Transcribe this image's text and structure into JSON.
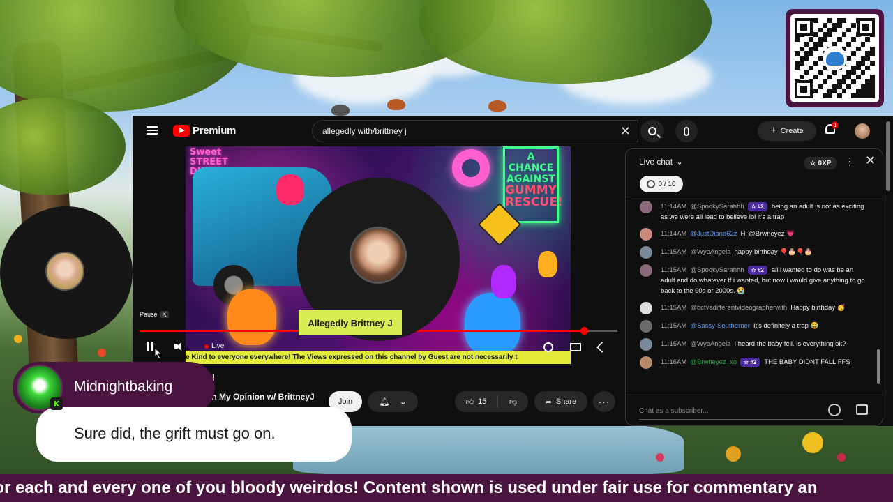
{
  "youtube": {
    "brand": "Premium",
    "search_value": "allegedly with/brittney j",
    "create_label": "Create",
    "notification_count": "1",
    "video": {
      "nameplate": "Allegedly Brittney J",
      "ticker_text": "e Kind to everyone everywhere! The Views expressed on this channel by Guest are not necessarily t",
      "pause_tooltip": "Pause",
      "pause_key": "K",
      "live_label": "Live",
      "progress": 0.93
    },
    "title_fragment": "y!",
    "channel_fragment": "In My Opinion w/ BrittneyJ",
    "join_label": "Join",
    "like_count": "15",
    "share_label": "Share"
  },
  "live_chat": {
    "title": "Live chat",
    "xp_badge": "0XP",
    "goal_pill": "0 / 10",
    "input_placeholder": "Chat as a subscriber...",
    "messages": [
      {
        "time": "11:14AM",
        "author": "@SpookySarahhh",
        "author_style": "default",
        "rank": "#2",
        "text": "being an adult is not as exciting as we were all lead to believe lol it's a trap",
        "avatar_color": "#8a6a7a"
      },
      {
        "time": "11:14AM",
        "author": "@JustDiana62z",
        "author_style": "blue",
        "rank": "",
        "text": "Hi @Brwneyez 💗",
        "avatar_color": "#c98a7a"
      },
      {
        "time": "11:15AM",
        "author": "@WyoAngela",
        "author_style": "default",
        "rank": "",
        "text": "happy birthday 🎈🎂🎈🎂",
        "avatar_color": "#7a8a9a"
      },
      {
        "time": "11:15AM",
        "author": "@SpookySarahhh",
        "author_style": "default",
        "rank": "#2",
        "text": "all i wanted to do was be an adult and do whatever tf i wanted, but now i would give anything to go back to the 90s or 2000s. 😭",
        "avatar_color": "#8a6a7a"
      },
      {
        "time": "11:15AM",
        "author": "@bctvadifferentvideographerwith",
        "author_style": "default",
        "rank": "",
        "text": "Happy birthday 🥳",
        "avatar_color": "#ddd"
      },
      {
        "time": "11:15AM",
        "author": "@Sassy-Southerner",
        "author_style": "blue",
        "rank": "",
        "text": "It's definitely a trap 😂",
        "avatar_color": "#6a6a6a"
      },
      {
        "time": "11:15AM",
        "author": "@WyoAngela",
        "author_style": "default",
        "rank": "",
        "text": "I heard the baby fell. is everything ok?",
        "avatar_color": "#7a8a9a"
      },
      {
        "time": "11:16AM",
        "author": "@Brwneyez_xo",
        "author_style": "member",
        "rank": "#2",
        "text": "THE BABY DIDNT FALL FFS",
        "avatar_color": "#b88a6a"
      }
    ]
  },
  "overlay": {
    "username": "Midnightbaking",
    "platform_badge": "K",
    "message": "Sure did, the grift must go on."
  },
  "bottom_ticker": "teful for each and every one of you bloody weirdos! Content shown is used under fair use for commentary an",
  "colors": {
    "youtube_red": "#ff0000",
    "overlay_purple": "#4a1440",
    "member_green": "#2ba640",
    "nameplate_yellow": "#d9ed55"
  }
}
